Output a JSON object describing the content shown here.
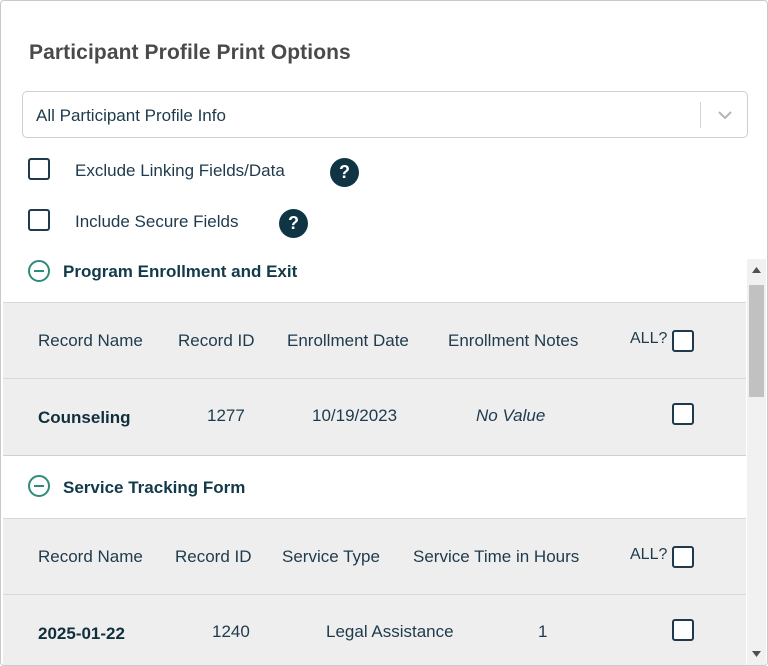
{
  "dialog": {
    "title": "Participant Profile Print Options"
  },
  "profile_select": {
    "value": "All Participant Profile Info",
    "icon": "chevron-down-icon"
  },
  "options": [
    {
      "label": "Exclude Linking Fields/Data",
      "checked": false,
      "help": "?"
    },
    {
      "label": "Include Secure Fields",
      "checked": false,
      "help": "?"
    }
  ],
  "sections": [
    {
      "title": "Program Enrollment and Exit",
      "icon": "collapse-circle-icon",
      "headers": [
        "Record Name",
        "Record ID",
        "Enrollment Date",
        "Enrollment Notes"
      ],
      "all_label": "ALL?",
      "rows": [
        {
          "cells": [
            "Counseling",
            "1277",
            "10/19/2023",
            "No Value"
          ],
          "checked": false
        }
      ]
    },
    {
      "title": "Service Tracking Form",
      "icon": "collapse-circle-icon",
      "headers": [
        "Record Name",
        "Record ID",
        "Service Type",
        "Service Time in Hours"
      ],
      "all_label": "ALL?",
      "rows": [
        {
          "cells": [
            "2025-01-22",
            "1240",
            "Legal Assistance",
            "1"
          ],
          "checked": false
        }
      ]
    }
  ],
  "colors": {
    "primary_text": "#1e3a4c",
    "help_bg": "#0f3545",
    "accent_teal": "#2e8b7a",
    "table_bg": "#eeeeee"
  }
}
